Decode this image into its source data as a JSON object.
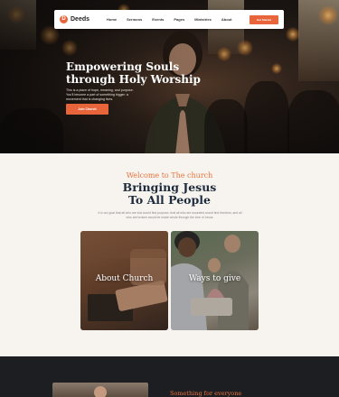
{
  "navbar": {
    "logo_mark": "D",
    "logo_text": "Deeds",
    "links": [
      "Home",
      "Sermons",
      "Events",
      "Pages",
      "Ministries",
      "About"
    ],
    "cta": "Get Started"
  },
  "hero": {
    "title": "Empowering Souls through Holy Worship",
    "subtitle": "This is a place of hope, meaning, and purpose. You'll become a part of something bigger: a movement that is changing lives.",
    "button": "Join Church"
  },
  "welcome": {
    "eyebrow": "Welcome to The church",
    "title": "Bringing Jesus To All People",
    "description": "It is our goal that all who are lost would find purpose, that all who are wounded would find freedom, and all who are broken would be made whole through the love of Jesus.",
    "cards": [
      {
        "label": "About Church"
      },
      {
        "label": "Ways to give"
      }
    ]
  },
  "next_section": {
    "eyebrow": "Something for everyone"
  },
  "colors": {
    "accent": "#e8643a",
    "heading": "#1d2b3c",
    "background": "#f7f4ef",
    "dark": "#1d1e21"
  }
}
